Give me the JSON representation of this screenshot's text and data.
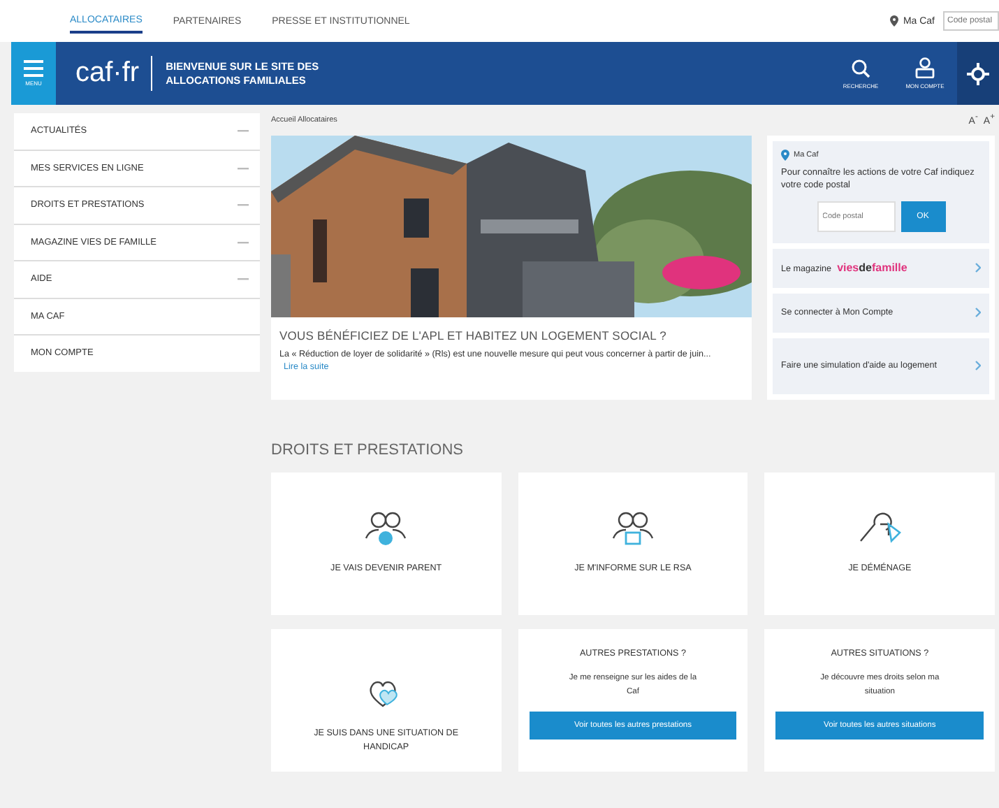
{
  "top_nav": {
    "links": [
      {
        "label": "ALLOCATAIRES",
        "selected": true
      },
      {
        "label": "PARTENAIRES",
        "selected": false
      },
      {
        "label": "PRESSE ET INSTITUTIONNEL",
        "selected": false
      }
    ],
    "ma_caf": "Ma Caf",
    "postal_placeholder": "Code postal"
  },
  "header": {
    "menu_label": "MENU",
    "logo": "caf·fr",
    "title_lines": [
      "BIENVENUE SUR LE SITE DES",
      "ALLOCATIONS FAMILIALES"
    ],
    "actions": [
      {
        "kind": "search",
        "label": "RECHERCHE"
      },
      {
        "kind": "account",
        "label": "MON COMPTE"
      },
      {
        "kind": "tools"
      }
    ]
  },
  "sidebar": {
    "items": [
      {
        "label": "ACTUALITÉS",
        "expandable": true
      },
      {
        "label": "MES SERVICES EN LIGNE",
        "expandable": true
      },
      {
        "label": "DROITS ET PRESTATIONS",
        "expandable": true
      },
      {
        "label": "MAGAZINE VIES DE FAMILLE",
        "expandable": true
      },
      {
        "label": "AIDE",
        "expandable": true
      },
      {
        "label": "MA CAF",
        "expandable": false
      },
      {
        "label": "MON COMPTE",
        "expandable": false
      }
    ]
  },
  "breadcrumb": "Accueil Allocataires",
  "font_size_controls": [
    "A$^{-}$",
    "A$^{+}$"
  ],
  "hero": {
    "title": "VOUS BÉNÉFICIEZ DE L'APL ET HABITEZ UN LOGEMENT SOCIAL ?",
    "text": "La « Réduction de loyer de solidarité » (Rls) est une nouvelle mesure qui peut vous concerner à partir de juin...",
    "link": "Lire la suite"
  },
  "ma_caf_panel": {
    "title": "Ma Caf",
    "text": "Pour connaître les actions de votre Caf indiquez votre code postal",
    "placeholder": "Code postal",
    "button": "OK",
    "links": [
      {
        "kind": "magazine",
        "label": "Le magazine",
        "brand": "vies**de**famille"
      },
      {
        "kind": "plain",
        "label": "Se connecter à Mon Compte"
      },
      {
        "kind": "plain",
        "label": "Faire une simulation d'aide au logement"
      }
    ]
  },
  "section": {
    "title": "DROITS ET PRESTATIONS",
    "cards": [
      {
        "kind": "topic",
        "label": "JE VAIS DEVENIR PARENT"
      },
      {
        "kind": "topic",
        "label": "JE M'INFORME SUR LE RSA"
      },
      {
        "kind": "topic",
        "label": "JE DÉMÉNAGE"
      },
      {
        "kind": "topic",
        "label": "JE SUIS DANS UNE SITUATION DE HANDICAP"
      },
      {
        "kind": "more",
        "title": "AUTRES PRESTATIONS ?",
        "text": "Je me renseigne sur les aides de la Caf",
        "button": "Voir toutes les autres prestations"
      },
      {
        "kind": "more",
        "title": "AUTRES SITUATIONS ?",
        "text": "Je découvre mes droits selon ma situation",
        "button": "Voir toutes les autres situations"
      }
    ]
  }
}
